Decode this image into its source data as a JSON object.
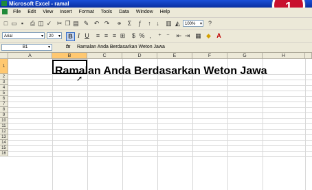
{
  "window": {
    "title": "Microsoft Excel - ramal"
  },
  "badge": {
    "label": "1"
  },
  "menu": [
    "File",
    "Edit",
    "View",
    "Insert",
    "Format",
    "Tools",
    "Data",
    "Window",
    "Help"
  ],
  "formatting": {
    "font_name": "Arial",
    "font_size": "20",
    "zoom": "100%"
  },
  "formula_bar": {
    "name_box": "B1",
    "fx_label": "fx",
    "content": "Ramalan Anda Berdasarkan Weton Jawa"
  },
  "sheet": {
    "columns": [
      "A",
      "B",
      "C",
      "D",
      "E",
      "F",
      "G",
      "H"
    ],
    "active_column": "B",
    "rows": [
      "1",
      "2",
      "3",
      "4",
      "5",
      "6",
      "7",
      "8",
      "9",
      "10",
      "11",
      "12",
      "13",
      "14",
      "15",
      "16"
    ],
    "cell_B1": "Ramalan Anda Berdasarkan Weton Jawa"
  },
  "colors": {
    "titlebar": "#0a2fa0",
    "badge": "#c8102e",
    "toolbar": "#ece9d8",
    "active_header": "#ffc870"
  }
}
